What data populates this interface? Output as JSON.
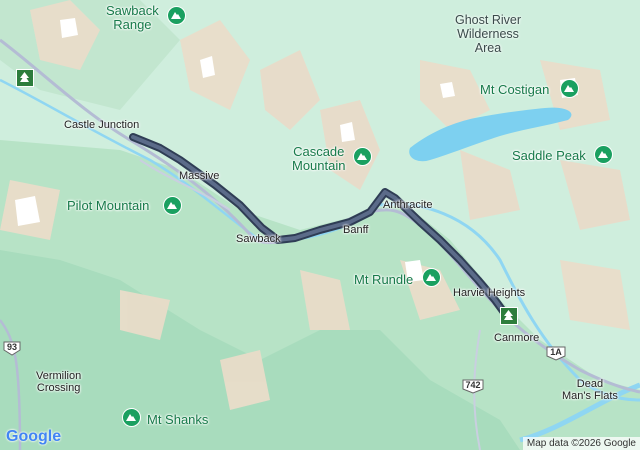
{
  "colors": {
    "land": "#cfeedd",
    "forest": "#a8dcbd",
    "water": "#7dd0f0",
    "road": "#b4bcd4",
    "route": "#3d4f6d",
    "route_outline": "#2f3d55",
    "peak_text": "#177a4a",
    "rock": "#e9dcc9",
    "snow": "#ffffff"
  },
  "map": {
    "peaks": [
      {
        "name": "Sawback\nRange"
      },
      {
        "name": "Pilot Mountain"
      },
      {
        "name": "Cascade\nMountain"
      },
      {
        "name": "Mt Costigan"
      },
      {
        "name": "Saddle Peak"
      },
      {
        "name": "Mt Rundle"
      },
      {
        "name": "Mt Shanks"
      }
    ],
    "places": [
      {
        "name": "Castle Junction"
      },
      {
        "name": "Massive"
      },
      {
        "name": "Sawback"
      },
      {
        "name": "Banff"
      },
      {
        "name": "Anthracite"
      },
      {
        "name": "Harvie Heights"
      },
      {
        "name": "Canmore"
      },
      {
        "name": "Vermilion\nCrossing"
      },
      {
        "name": "Dead\nMan's Flats"
      }
    ],
    "areas": [
      {
        "name": "Ghost River\nWilderness\nArea"
      }
    ],
    "highway_shields": [
      {
        "label": "93"
      },
      {
        "label": "742"
      },
      {
        "label": "1A"
      }
    ],
    "park_icons": [
      {
        "name": "park-entrance-icon-north"
      },
      {
        "name": "park-entrance-icon-canmore"
      }
    ]
  },
  "footer": {
    "logo": "Google",
    "attribution": "Map data ©2026 Google"
  }
}
